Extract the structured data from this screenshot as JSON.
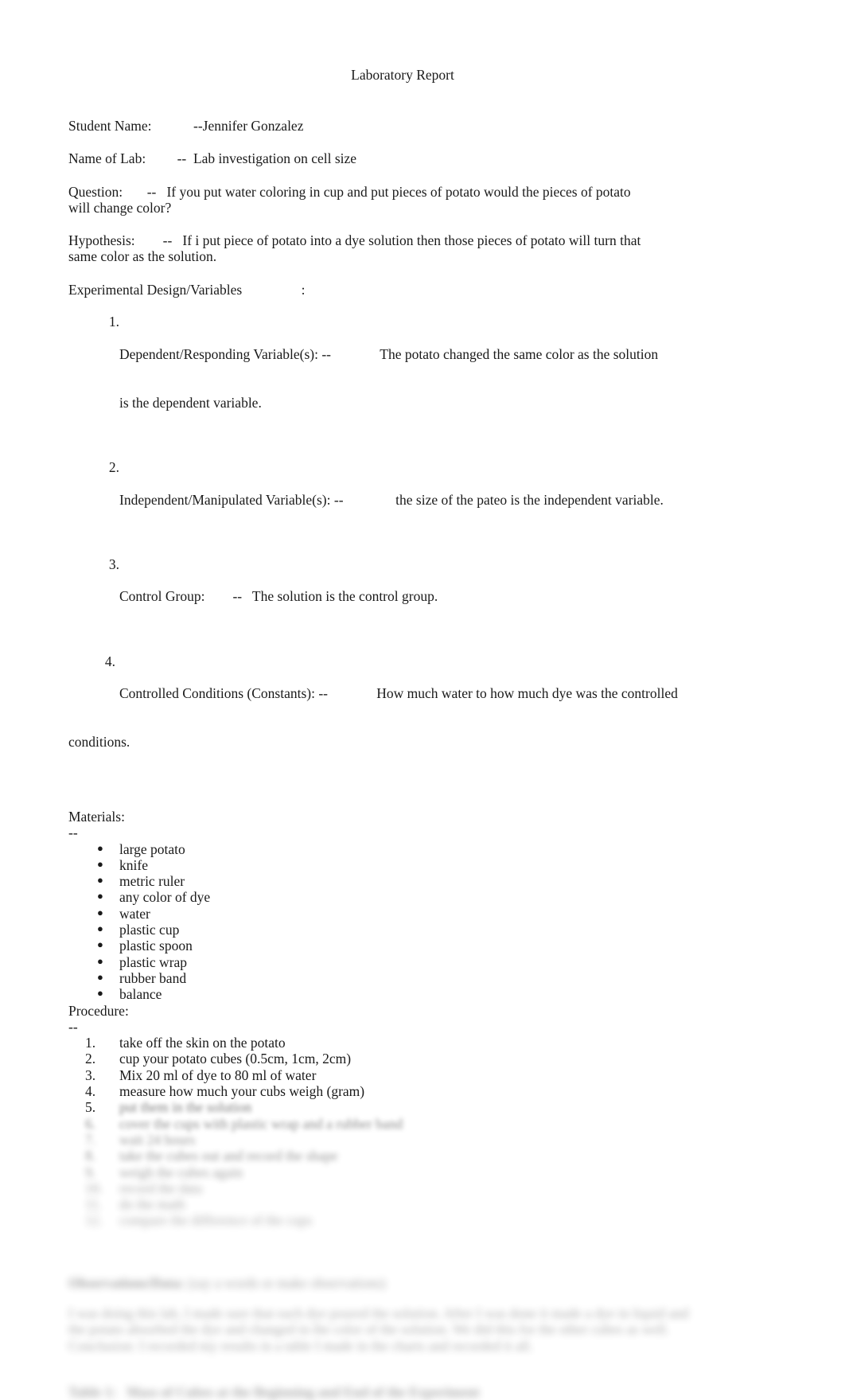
{
  "document": {
    "title": "Laboratory Report",
    "fields": [
      {
        "label": "Student Name:",
        "gap": "            ",
        "dash": "--",
        "value": "Jennifer Gonzalez"
      },
      {
        "label": "Name of Lab:",
        "gap": "         ",
        "dash": "--",
        "value": "  Lab investigation on cell size"
      }
    ],
    "question": {
      "label": "Question:",
      "gap": "       ",
      "dash": "--",
      "line1": "   If you put water coloring in cup and put pieces of potato would the pieces of potato",
      "line2": "will change color?"
    },
    "hypothesis": {
      "label": "Hypothesis:",
      "gap": "        ",
      "dash": "--",
      "line1": "   If i put piece of potato into a dye solution then those pieces of potato will turn that",
      "line2": "same color as the solution."
    },
    "experimental_design": {
      "heading": "Experimental Design/Variables",
      "heading_gap": "                 ",
      "heading_colon": ":",
      "items": [
        {
          "number": "1.",
          "label": "Dependent/Responding Variable(s): --",
          "gap": "              ",
          "value": "The potato changed the same color as the solution",
          "continuation": "is the dependent variable."
        },
        {
          "number": "2.",
          "label": "Independent/Manipulated Variable(s): --",
          "gap": "               ",
          "value": "the size of the pateo is the independent variable.",
          "continuation": ""
        },
        {
          "number": "3.",
          "label": "Control Group:",
          "gap": "        ",
          "dash": "--",
          "value": "   The solution is the control group.",
          "continuation": ""
        },
        {
          "number": "4.",
          "label": "Controlled Conditions (Constants): --",
          "gap": "              ",
          "value": "How much water to how much dye was the controlled",
          "continuation": "conditions."
        }
      ]
    },
    "materials": {
      "heading": "Materials:",
      "dash": "--",
      "bullet_glyph": "●",
      "items": [
        "large potato",
        "knife",
        "metric ruler",
        "any color of dye",
        "water",
        "plastic cup",
        "plastic spoon",
        "plastic wrap",
        "rubber band",
        "balance"
      ]
    },
    "procedure": {
      "heading": "Procedure:",
      "dash": "--",
      "items": [
        {
          "number": "1.",
          "text": "take off the skin on the potato",
          "obscured": false
        },
        {
          "number": "2.",
          "text": "cup your potato cubes (0.5cm, 1cm, 2cm)",
          "obscured": false
        },
        {
          "number": "3.",
          "text": "Mix 20 ml of dye to 80 ml of water",
          "obscured": false
        },
        {
          "number": "4.",
          "text": "measure how much your cubs weigh (gram)",
          "obscured": false
        },
        {
          "number": "5.",
          "text": "put them in the solution",
          "obscured": true,
          "blur": 1
        },
        {
          "number": "6.",
          "text": "cover the cups with plastic wrap and a rubber band",
          "obscured": true,
          "blur": 2
        },
        {
          "number": "7.",
          "text": "wait 24 hours",
          "obscured": true,
          "blur": 3
        },
        {
          "number": "8.",
          "text": "take the cubes out and record the shape",
          "obscured": true,
          "blur": 3
        },
        {
          "number": "9.",
          "text": "weigh the cubes again",
          "obscured": true,
          "blur": 4
        },
        {
          "number": "10.",
          "text": "record the data",
          "obscured": true,
          "blur": 5
        },
        {
          "number": "11.",
          "text": "do the math",
          "obscured": true,
          "blur": 5
        },
        {
          "number": "12.",
          "text": "compare the difference of the cups",
          "obscured": true,
          "blur": 6
        }
      ]
    },
    "observations": {
      "heading_bold": "Observations/Data:",
      "heading_rest": " (say a words or make observations)",
      "paragraph_lines": [
        "I was doing this lab, I made sure that each dye poured the solution. After I was done it made a dye in liquid and",
        "the potato absorbed the dye and changed in the color of the solution. We did this for the other cubes as well.",
        "Conclusion: I recorded my results in a table I made in the charts and recorded it all."
      ]
    },
    "table_caption": {
      "label": "Table 1:",
      "text": "Mass of Cubes at the Beginning and End of the Experiment"
    }
  }
}
